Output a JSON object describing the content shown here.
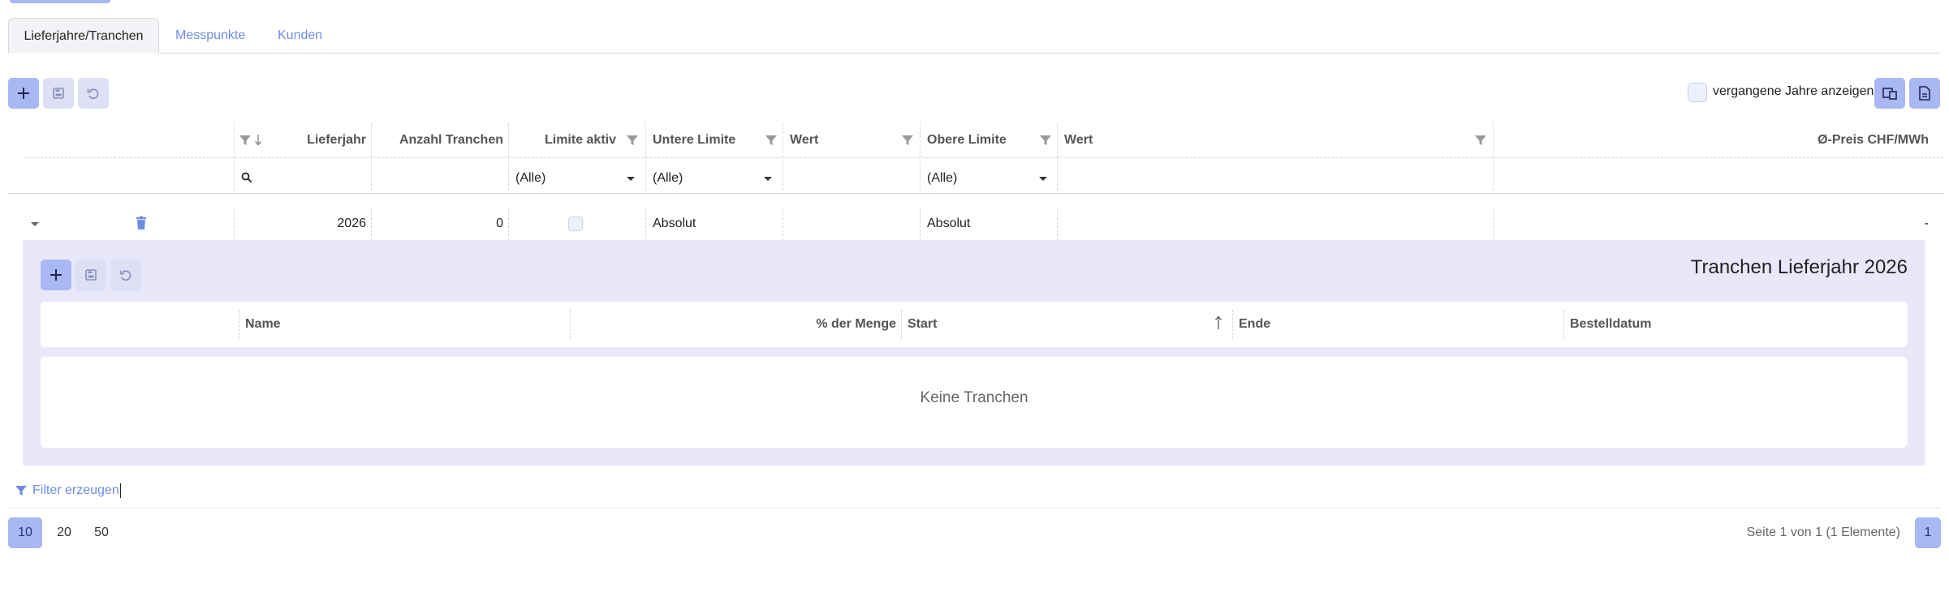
{
  "tabs": [
    {
      "label": "Lieferjahre/Tranchen",
      "active": true
    },
    {
      "label": "Messpunkte",
      "active": false
    },
    {
      "label": "Kunden",
      "active": false
    }
  ],
  "toolbar": {
    "show_past_years_label": "vergangene Jahre anzeigen"
  },
  "grid": {
    "columns": {
      "lieferjahr": "Lieferjahr",
      "anzahl_tranchen": "Anzahl Tranchen",
      "limite_aktiv": "Limite aktiv",
      "untere_limite": "Untere Limite",
      "wert1": "Wert",
      "obere_limite": "Obere Limite",
      "wert2": "Wert",
      "preis": "Ø-Preis CHF/MWh"
    },
    "filters": {
      "limite_aktiv": "(Alle)",
      "untere_limite": "(Alle)",
      "obere_limite": "(Alle)"
    },
    "row": {
      "lieferjahr": "2026",
      "anzahl_tranchen": "0",
      "untere_limite": "Absolut",
      "obere_limite": "Absolut",
      "preis": "-"
    }
  },
  "detail": {
    "title": "Tranchen Lieferjahr 2026",
    "columns": {
      "name": "Name",
      "menge": "% der Menge",
      "start": "Start",
      "ende": "Ende",
      "bestelldatum": "Bestelldatum"
    },
    "empty_text": "Keine Tranchen"
  },
  "footer": {
    "filter_link": "Filter erzeugen",
    "page_sizes": [
      "10",
      "20",
      "50"
    ],
    "page_info": "Seite 1 von 1 (1 Elemente)",
    "current_page": "1"
  },
  "colors": {
    "accent": "#6f8de6",
    "button_primary": "#a9b8f3",
    "button_secondary": "#dde0f5",
    "detail_bg": "#e9e8fb"
  }
}
